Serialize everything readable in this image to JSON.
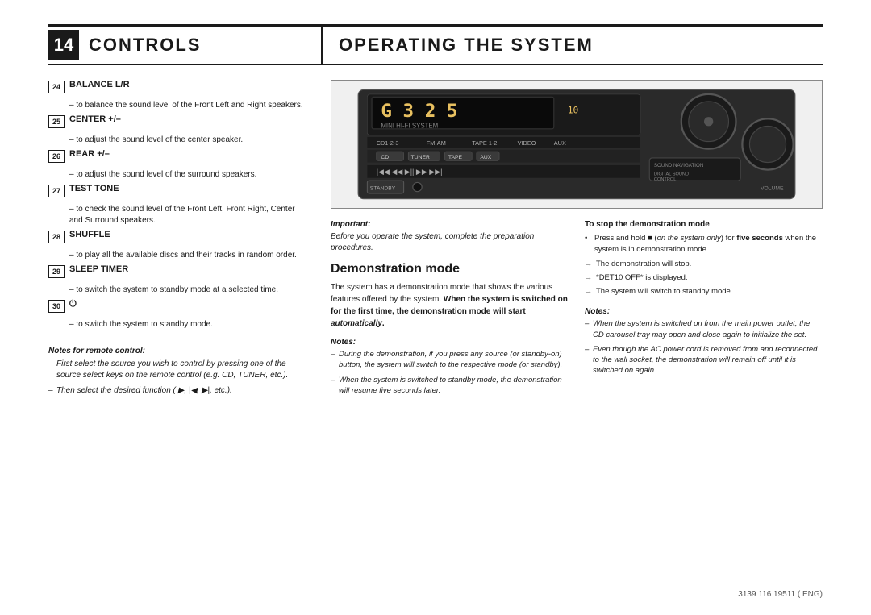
{
  "header": {
    "chapter_number": "14",
    "left_title": "CONTROLS",
    "right_title": "OPERATING THE SYSTEM"
  },
  "left_column": {
    "items": [
      {
        "num": "24",
        "label": "BALANCE L/R",
        "desc": "to balance the sound level of the Front Left and Right speakers."
      },
      {
        "num": "25",
        "label": "CENTER +/–",
        "desc": "to adjust the sound level of the center speaker."
      },
      {
        "num": "26",
        "label": "REAR +/–",
        "desc": "to adjust the sound level of the surround speakers."
      },
      {
        "num": "27",
        "label": "TEST TONE",
        "desc": "to check the sound level of the Front Left, Front Right, Center and Surround speakers."
      },
      {
        "num": "28",
        "label": "SHUFFLE",
        "desc": "to play all the available discs and their tracks in random order."
      },
      {
        "num": "29",
        "label": "SLEEP TIMER",
        "desc": "to switch the system to standby mode at a selected time."
      },
      {
        "num": "30",
        "label": "⏻",
        "desc": "to switch the system to standby mode."
      }
    ],
    "remote_notes": {
      "title": "Notes for remote control:",
      "items": [
        "First select the source you wish to control by pressing one of the source select keys on the remote control (e.g. CD, TUNER, etc.).",
        "Then select the desired function ( ▶, |◀, ▶|, etc.)."
      ]
    }
  },
  "right_column": {
    "important": {
      "title": "Important:",
      "text": "Before you operate the system, complete the preparation procedures."
    },
    "demo_section": {
      "title": "Demonstration mode",
      "body": "The system has a demonstration mode that shows the various features offered by the system. When the system is switched on for the first time, the demonstration mode will start automatically.",
      "notes_label": "Notes:",
      "notes": [
        "During the demonstration, if you press any source (or standby-on) button, the system will switch to the respective mode (or standby).",
        "When the system is switched to standby mode, the demonstration will resume five seconds later."
      ]
    },
    "stop_demo": {
      "title": "To stop the demonstration mode",
      "intro": "Press and hold ■ (on the system only) for five seconds when the system is in demonstration mode.",
      "arrows": [
        "The demonstration will stop.",
        "*DET10  OFF* is displayed.",
        "The system will switch to standby mode."
      ]
    },
    "right_notes_label": "Notes:",
    "right_notes": [
      "When the system is switched on from the main power outlet, the CD carousel tray may open and close again to initialize the set.",
      "Even though the AC power cord is removed from and reconnected to the wall socket, the demonstration will remain off until it is switched on again."
    ]
  },
  "footer": {
    "text": "3139 116 19511 ( ENG)"
  }
}
